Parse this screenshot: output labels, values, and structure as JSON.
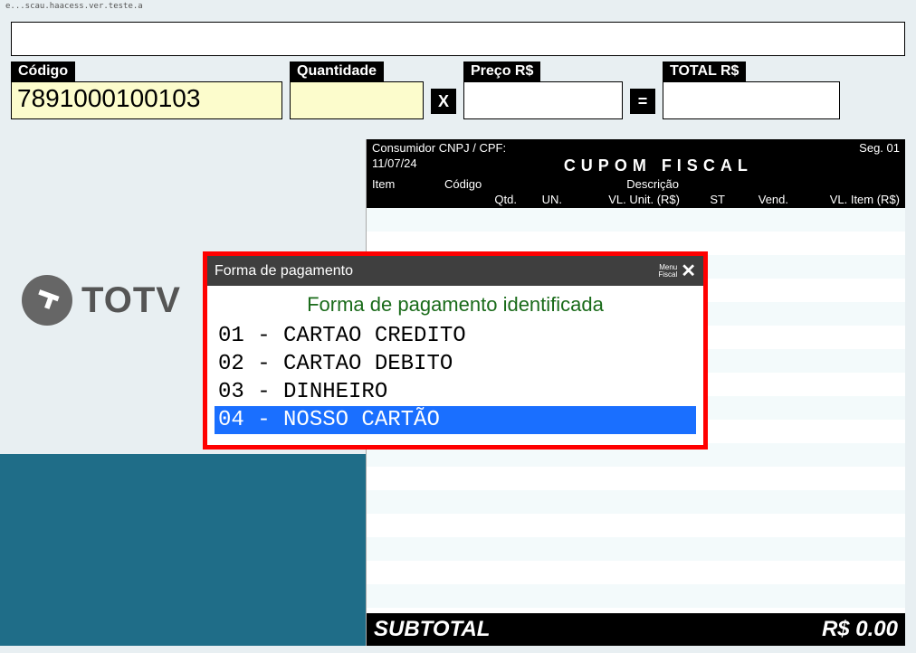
{
  "titlebar": "e...scau.haacess.ver.teste.a",
  "fields": {
    "codigo_label": "Código",
    "codigo_value": "7891000100103",
    "qtd_label": "Quantidade",
    "qtd_value": "",
    "preco_label": "Preço R$",
    "preco_value": "",
    "total_label": "TOTAL R$",
    "total_value": "",
    "op_mult": "X",
    "op_eq": "="
  },
  "logo_text": "TOTV",
  "cupom": {
    "consumidor_label": "Consumidor CNPJ / CPF:",
    "seg": "Seg. 01",
    "date": "11/07/24",
    "title": "CUPOM FISCAL",
    "h_item": "Item",
    "h_codigo": "Código",
    "h_desc": "Descrição",
    "h_qtd": "Qtd.",
    "h_un": "UN.",
    "h_vlunit": "VL. Unit. (R$)",
    "h_st": "ST",
    "h_vend": "Vend.",
    "h_vlitem": "VL. Item (R$)"
  },
  "subtotal": {
    "label": "SUBTOTAL",
    "value": "R$ 0.00"
  },
  "modal": {
    "title": "Forma de pagamento",
    "menu_fiscal_l1": "Menu",
    "menu_fiscal_l2": "Fiscal",
    "header": "Forma de pagamento identificada",
    "items": [
      {
        "code": "01",
        "label": "CARTAO CREDITO",
        "selected": false
      },
      {
        "code": "02",
        "label": "CARTAO DEBITO",
        "selected": false
      },
      {
        "code": "03",
        "label": "DINHEIRO",
        "selected": false
      },
      {
        "code": "04",
        "label": "NOSSO CARTÃO",
        "selected": true
      }
    ]
  }
}
